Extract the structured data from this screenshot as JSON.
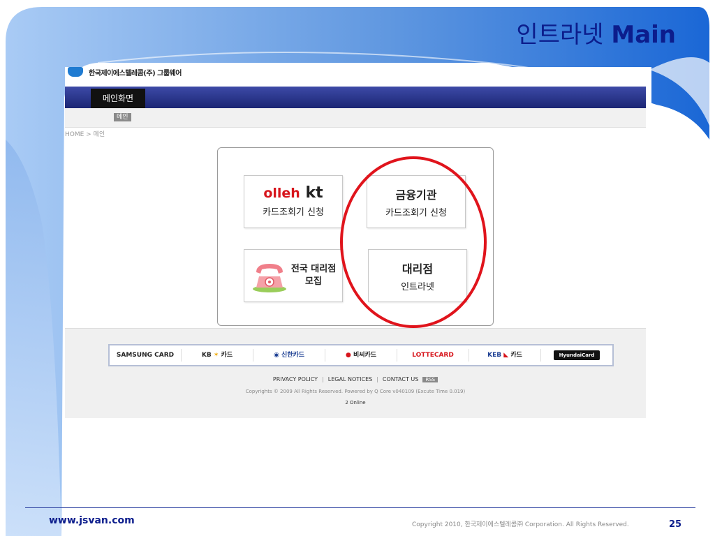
{
  "slide": {
    "title_korean": "인트라넷",
    "title_english": "Main",
    "url": "www.jsvan.com",
    "copyright": "Copyright 2010, 한국제이에스텔레콤㈜ Corporation. All Rights Reserved.",
    "page_number": "25"
  },
  "site": {
    "company_name": "한국제이에스텔레콤(주) 그룹웨어",
    "nav_main": "메인화면",
    "sub_tag": "메인",
    "breadcrumb": "HOME > 메인"
  },
  "cards": {
    "kt": {
      "olleh": "olleh",
      "kt": "kt",
      "subtitle": "카드조회기 신청"
    },
    "finance": {
      "title": "금융기관",
      "subtitle": "카드조회기 신청"
    },
    "recruit": {
      "line1": "전국 대리점",
      "line2": "모집"
    },
    "intranet": {
      "title": "대리점",
      "subtitle": "인트라넷"
    }
  },
  "footer": {
    "card_logos": [
      "SAMSUNG CARD",
      "KB",
      "카드",
      "신한카드",
      "비씨카드",
      "LOTTECARD",
      "KEB",
      "카드",
      "HyundaiCard"
    ],
    "links": [
      "PRIVACY POLICY",
      "LEGAL NOTICES",
      "CONTACT US"
    ],
    "rss": "RSS",
    "copyright": "Copyrights © 2009 All Rights Reserved. Powered by Q Core v040109 (Excute Time 0.019)",
    "online": "2 Online"
  },
  "colors": {
    "title_blue": "#0c1d8c",
    "nav_blue": "#2a3590",
    "highlight_red": "#e0141c"
  }
}
